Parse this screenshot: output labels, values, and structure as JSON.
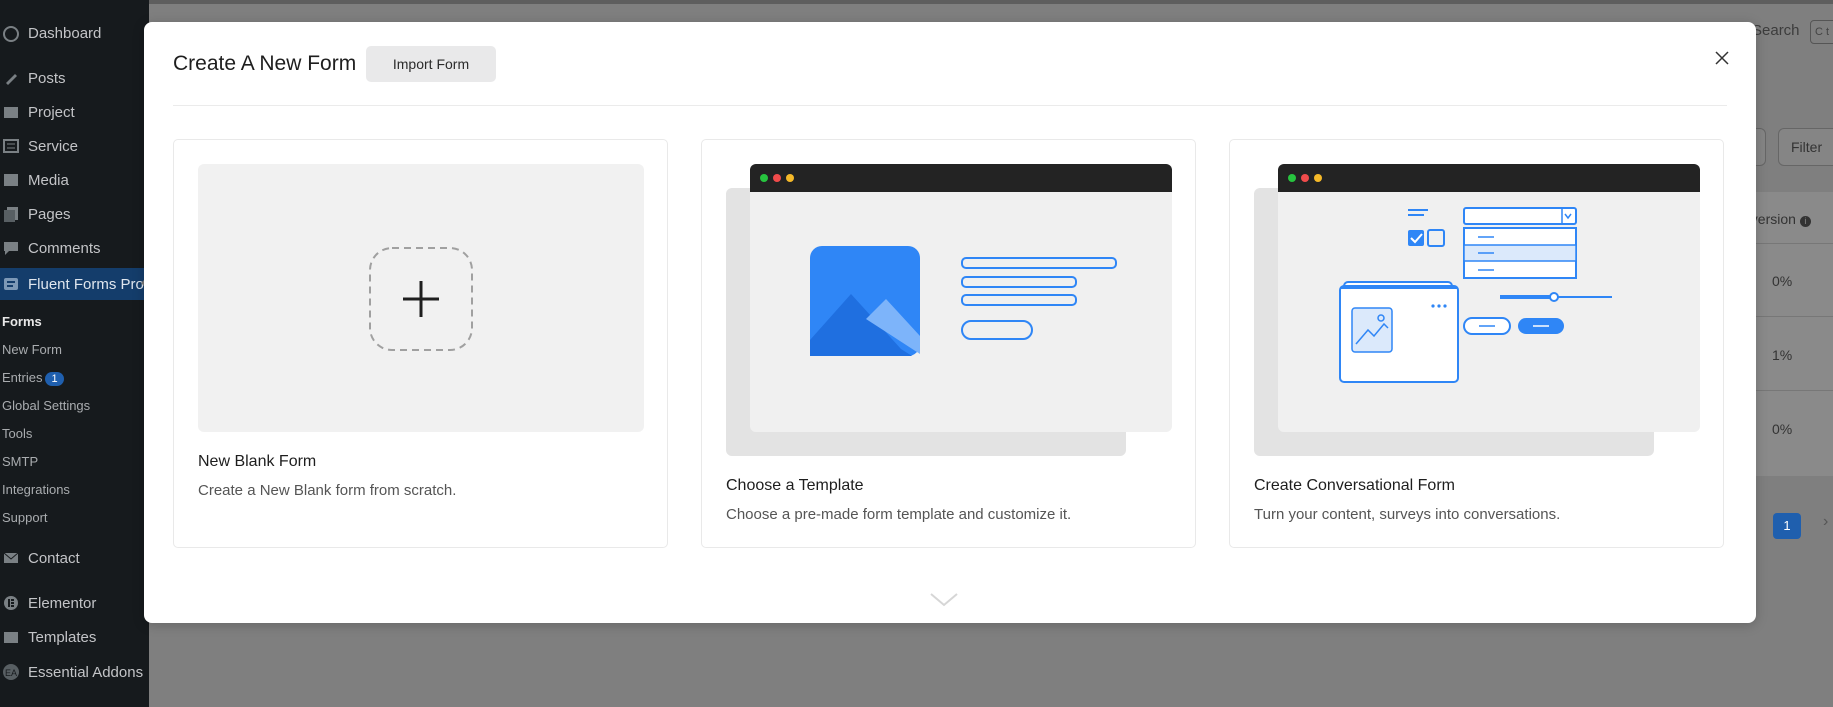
{
  "sidebar": {
    "top_items": [
      {
        "label": "Dashboard",
        "icon": "dashboard-icon"
      },
      {
        "label": "Posts",
        "icon": "pin-icon"
      },
      {
        "label": "Project",
        "icon": "folder-icon"
      },
      {
        "label": "Service",
        "icon": "list-icon"
      },
      {
        "label": "Media",
        "icon": "media-icon"
      },
      {
        "label": "Pages",
        "icon": "pages-icon"
      },
      {
        "label": "Comments",
        "icon": "comment-icon"
      },
      {
        "label": "Fluent Forms Pro",
        "icon": "fluent-forms-icon"
      }
    ],
    "submenu": [
      {
        "label": "Forms"
      },
      {
        "label": "New Form"
      },
      {
        "label": "Entries",
        "badge": "1"
      },
      {
        "label": "Global Settings"
      },
      {
        "label": "Tools"
      },
      {
        "label": "SMTP"
      },
      {
        "label": "Integrations"
      },
      {
        "label": "Support"
      }
    ],
    "bottom_items": [
      {
        "label": "Contact",
        "icon": "mail-icon"
      },
      {
        "label": "Elementor",
        "icon": "elementor-icon"
      },
      {
        "label": "Templates",
        "icon": "folder-icon"
      },
      {
        "label": "Essential Addons",
        "icon": "ea-icon"
      }
    ]
  },
  "background": {
    "search_label": "Search",
    "kbd_hint": "C t",
    "filter_label": "Filter",
    "column_header": "nversion",
    "rows": [
      "0%",
      "1%",
      "0%"
    ],
    "current_page": "1"
  },
  "modal": {
    "title": "Create A New Form",
    "import_label": "Import Form",
    "cards": [
      {
        "title": "New Blank Form",
        "description": "Create a New Blank form from scratch."
      },
      {
        "title": "Choose a Template",
        "description": "Choose a pre-made form template and customize it."
      },
      {
        "title": "Create Conversational Form",
        "description": "Turn your content, surveys into conversations."
      }
    ]
  },
  "colors": {
    "accent": "#1f7bf2",
    "sidebar_bg": "#161a1d",
    "sidebar_active": "#143d6b",
    "overlay": "#7f7f7f"
  }
}
